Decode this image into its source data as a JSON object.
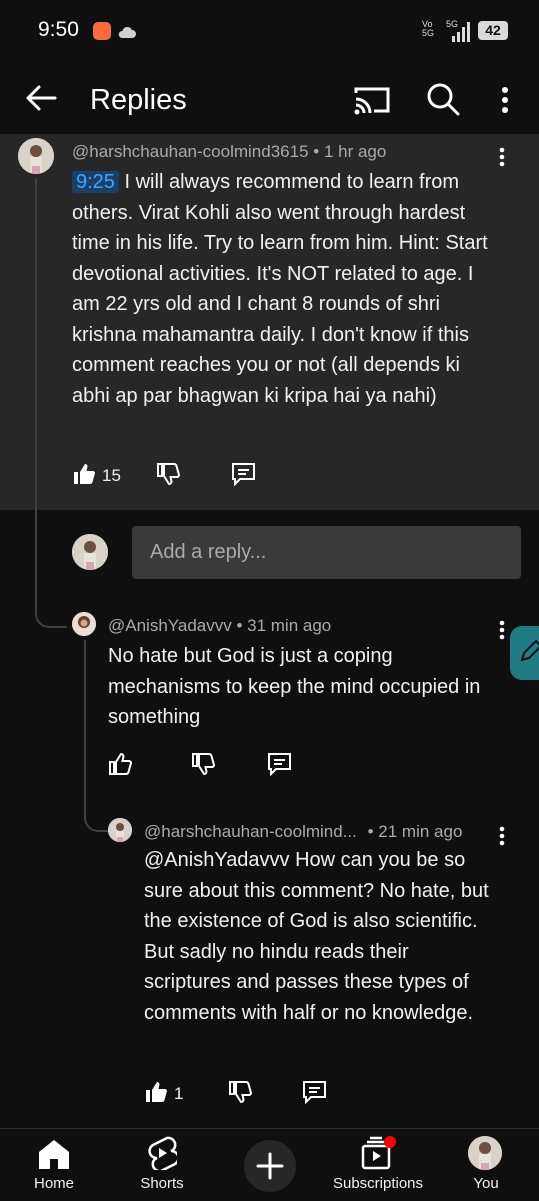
{
  "status_bar": {
    "time": "9:50",
    "network": "5G",
    "volte": "Vo\n5G",
    "battery": "42"
  },
  "header": {
    "title": "Replies"
  },
  "parent_comment": {
    "handle": "@harshchauhan-coolmind3615",
    "time": "• 1 hr ago",
    "timestamp_link": "9:25",
    "text": "I will always recommend to learn from others. Virat Kohli also went through hardest time in his life. Try to learn from him. Hint: Start devotional activities. It's NOT related to age. I am 22 yrs old and I chant 8 rounds of shri krishna mahamantra daily. I don't know if this comment reaches you or not (all depends ki abhi ap par bhagwan ki kripa hai ya nahi)",
    "likes": "15"
  },
  "reply_input": {
    "placeholder": "Add a reply..."
  },
  "replies": [
    {
      "handle": "@AnishYadavvv",
      "time": "• 31 min ago",
      "text": "No hate but God is just a coping mechanisms to keep the mind occupied in something",
      "likes": ""
    },
    {
      "handle": "@harshchauhan-coolmind...",
      "time": "• 21 min ago",
      "text": "@AnishYadavvv How can you be so sure about this comment? No hate, but the existence of God is also scientific. But sadly no hindu reads their scriptures and passes these types of comments with half or no knowledge.",
      "likes": "1"
    }
  ],
  "bottom_nav": {
    "home": "Home",
    "shorts": "Shorts",
    "subscriptions": "Subscriptions",
    "you": "You"
  },
  "colors": {
    "background": "#0f0f0f",
    "highlight": "#272727",
    "accent_blue": "#3ea6ff",
    "notification_red": "#ff0000"
  }
}
